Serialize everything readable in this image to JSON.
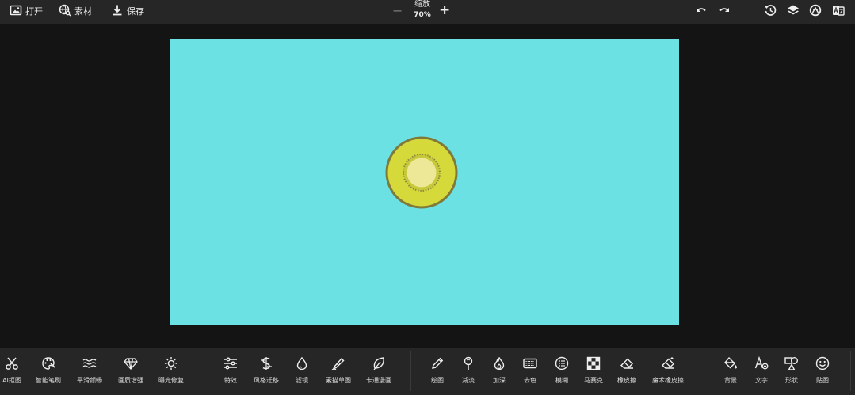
{
  "topbar": {
    "open_label": "打开",
    "material_label": "素材",
    "save_label": "保存",
    "zoom_label": "缩放",
    "zoom_value": "70%",
    "zoom_minus": "−",
    "zoom_plus": "+"
  },
  "canvas": {
    "background": "#6ce1e4"
  },
  "bottombar": {
    "tools": [
      {
        "label": "AI抠图",
        "icon": "scissors-icon"
      },
      {
        "label": "智能笔刷",
        "icon": "palette-icon"
      },
      {
        "label": "平滑颜畅",
        "icon": "waves-icon"
      },
      {
        "label": "画质增强",
        "icon": "diamond-icon"
      },
      {
        "label": "曝光修复",
        "icon": "sun-icon"
      },
      {
        "label": "特效",
        "icon": "sliders-icon"
      },
      {
        "label": "风格迁移",
        "icon": "style-transfer-icon"
      },
      {
        "label": "滤镜",
        "icon": "drop-icon"
      },
      {
        "label": "素描草图",
        "icon": "pen-sketch-icon"
      },
      {
        "label": "卡通漫画",
        "icon": "leaf-icon"
      },
      {
        "label": "绘图",
        "icon": "pencil-icon"
      },
      {
        "label": "减淡",
        "icon": "dodge-icon"
      },
      {
        "label": "加深",
        "icon": "flame-icon"
      },
      {
        "label": "去色",
        "icon": "desaturate-icon"
      },
      {
        "label": "模糊",
        "icon": "blur-icon"
      },
      {
        "label": "马赛克",
        "icon": "mosaic-icon"
      },
      {
        "label": "橡皮擦",
        "icon": "eraser-icon"
      },
      {
        "label": "魔术橡皮擦",
        "icon": "magic-eraser-icon"
      },
      {
        "label": "背景",
        "icon": "paint-bucket-icon"
      },
      {
        "label": "文字",
        "icon": "text-add-icon"
      },
      {
        "label": "形状",
        "icon": "shapes-icon"
      },
      {
        "label": "贴图",
        "icon": "sticker-icon"
      }
    ]
  }
}
